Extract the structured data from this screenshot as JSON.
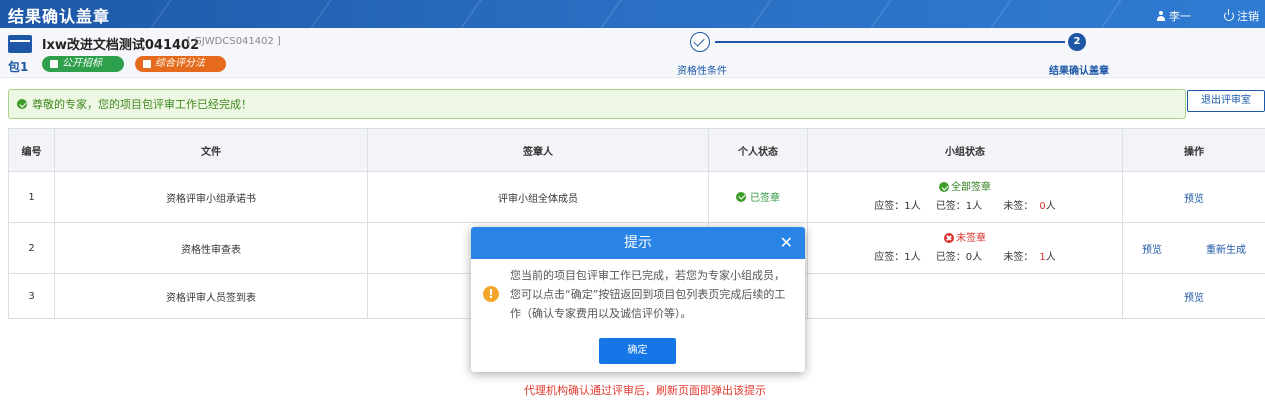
{
  "topbar": {
    "title": "结果确认盖章",
    "user": "李一",
    "logout": "注销"
  },
  "header": {
    "project_name": "lxw改进文档测试041402",
    "project_code": "[ GJWDCS041402 ]",
    "package_label": "包1",
    "badges": [
      "公开招标",
      "综合评分法"
    ]
  },
  "steps": [
    {
      "label": "资格性条件",
      "state": "done"
    },
    {
      "label": "结果确认盖章",
      "number": "2",
      "state": "current"
    }
  ],
  "notice": {
    "text": "尊敬的专家，您的项目包评审工作已经完成！"
  },
  "exit_button": "退出评审室",
  "table": {
    "headers": [
      "编号",
      "文件",
      "签章人",
      "个人状态",
      "小组状态",
      "操作"
    ],
    "rows": [
      {
        "no": "1",
        "file": "资格评审小组承诺书",
        "signer": "评审小组全体成员",
        "personal_status": "已签章",
        "group_status": "全部签章",
        "should_label": "应签：1人",
        "signed_label": "已签：1人",
        "unsigned_label": "未签：",
        "unsigned_count": "0",
        "unsigned_unit": "人",
        "ops": [
          "预览"
        ]
      },
      {
        "no": "2",
        "file": "资格性审查表",
        "signer": "",
        "personal_status": "",
        "group_status": "未签章",
        "should_label": "应签：1人",
        "signed_label": "已签：0人",
        "unsigned_label": "未签：",
        "unsigned_count": "1",
        "unsigned_unit": "人",
        "ops": [
          "预览",
          "重新生成"
        ]
      },
      {
        "no": "3",
        "file": "资格评审人员签到表",
        "signer": "",
        "personal_status": "",
        "group_status": "",
        "ops": [
          "预览"
        ]
      }
    ]
  },
  "modal": {
    "title": "提示",
    "close": "✕",
    "icon": "!",
    "message": "您当前的项目包评审工作已完成，若您为专家小组成员，您可以点击“确定”按钮返回到项目包列表页完成后续的工作（确认专家费用以及诚信评价等）。",
    "ok": "确定"
  },
  "footer_note": "代理机构确认通过评审后，刷新页面即弹出该提示",
  "colors": {
    "primary": "#1d58a6",
    "modal_header": "#2a84e6",
    "success": "#2e9a3f",
    "danger": "#d9322b",
    "warning": "#f4a62a"
  }
}
